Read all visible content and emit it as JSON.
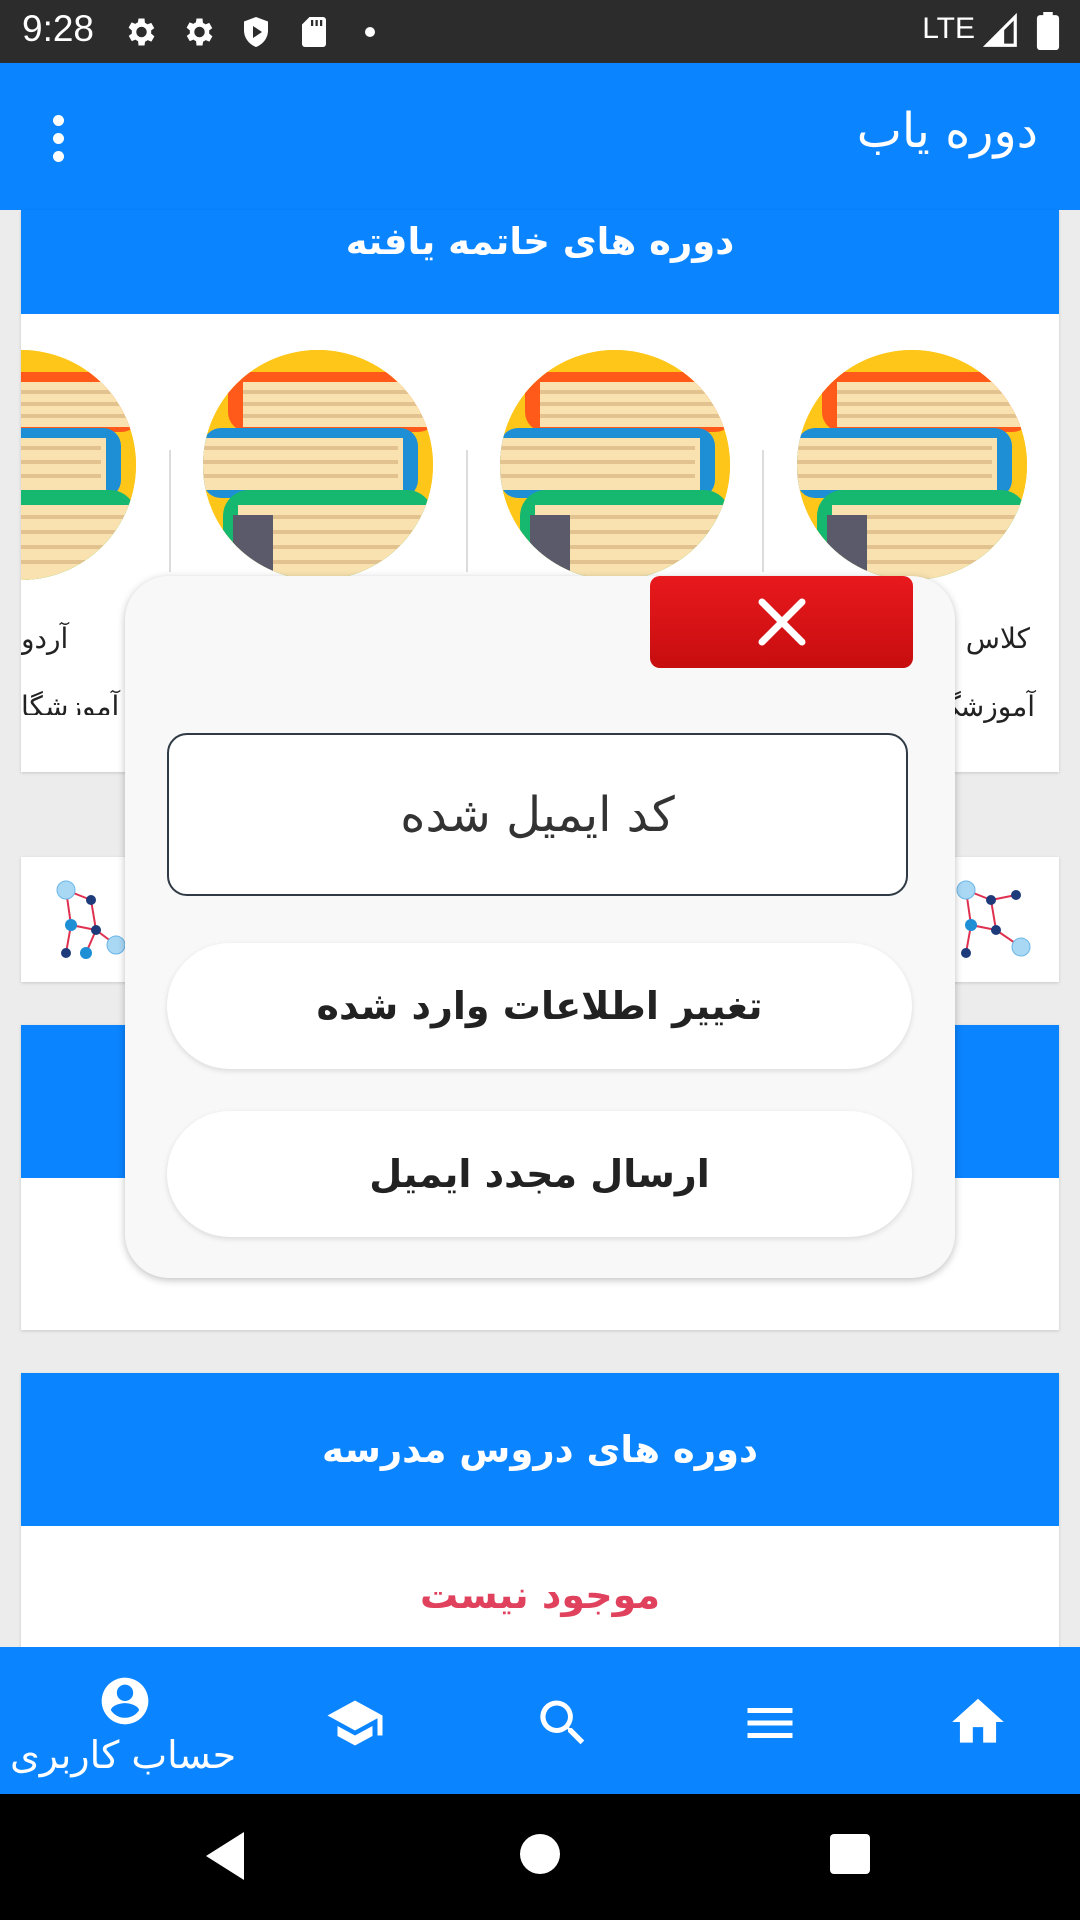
{
  "status_bar": {
    "time": "9:28",
    "network": "LTE",
    "icons": [
      "gear-icon",
      "gear-icon",
      "shield-icon",
      "sd-card-icon",
      "dot-icon",
      "signal-icon",
      "battery-icon"
    ]
  },
  "app_bar": {
    "title": "دوره یاب",
    "menu_icon": "more-vert-icon"
  },
  "finished_courses": {
    "header": "دوره های خاتمه یافته",
    "items": [
      {
        "title": "کلاس",
        "institute": "آموزشگ"
      },
      {
        "title": "",
        "institute": ""
      },
      {
        "title": "",
        "institute": ""
      },
      {
        "title": "آردو",
        "institute": "آموزشگا"
      }
    ]
  },
  "school_courses": {
    "header": "دوره های دروس مدرسه",
    "empty_text": "موجود نیست"
  },
  "dialog": {
    "input_placeholder": "کد ایمیل شده",
    "change_info_label": "تغییر اطلاعات وارد شده",
    "resend_email_label": "ارسال مجدد ایمیل",
    "close_icon": "close-icon"
  },
  "bottom_nav": {
    "items": [
      {
        "icon": "account-icon",
        "label": "حساب کاربری"
      },
      {
        "icon": "graduation-cap-icon"
      },
      {
        "icon": "search-icon"
      },
      {
        "icon": "menu-icon"
      },
      {
        "icon": "home-icon"
      }
    ]
  },
  "colors": {
    "primary": "#0a84ff",
    "danger": "#e8191d",
    "empty_text": "#e0425e",
    "status_bar": "#2c2c2c"
  }
}
